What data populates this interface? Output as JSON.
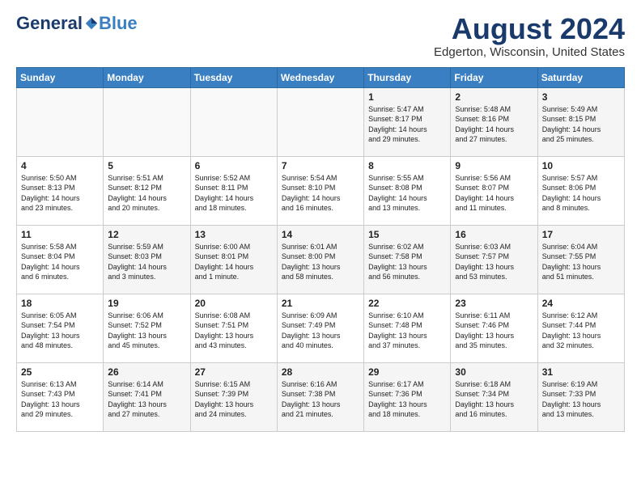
{
  "header": {
    "logo_general": "General",
    "logo_blue": "Blue",
    "title": "August 2024",
    "subtitle": "Edgerton, Wisconsin, United States"
  },
  "days_of_week": [
    "Sunday",
    "Monday",
    "Tuesday",
    "Wednesday",
    "Thursday",
    "Friday",
    "Saturday"
  ],
  "weeks": [
    [
      {
        "day": "",
        "info": ""
      },
      {
        "day": "",
        "info": ""
      },
      {
        "day": "",
        "info": ""
      },
      {
        "day": "",
        "info": ""
      },
      {
        "day": "1",
        "info": "Sunrise: 5:47 AM\nSunset: 8:17 PM\nDaylight: 14 hours\nand 29 minutes."
      },
      {
        "day": "2",
        "info": "Sunrise: 5:48 AM\nSunset: 8:16 PM\nDaylight: 14 hours\nand 27 minutes."
      },
      {
        "day": "3",
        "info": "Sunrise: 5:49 AM\nSunset: 8:15 PM\nDaylight: 14 hours\nand 25 minutes."
      }
    ],
    [
      {
        "day": "4",
        "info": "Sunrise: 5:50 AM\nSunset: 8:13 PM\nDaylight: 14 hours\nand 23 minutes."
      },
      {
        "day": "5",
        "info": "Sunrise: 5:51 AM\nSunset: 8:12 PM\nDaylight: 14 hours\nand 20 minutes."
      },
      {
        "day": "6",
        "info": "Sunrise: 5:52 AM\nSunset: 8:11 PM\nDaylight: 14 hours\nand 18 minutes."
      },
      {
        "day": "7",
        "info": "Sunrise: 5:54 AM\nSunset: 8:10 PM\nDaylight: 14 hours\nand 16 minutes."
      },
      {
        "day": "8",
        "info": "Sunrise: 5:55 AM\nSunset: 8:08 PM\nDaylight: 14 hours\nand 13 minutes."
      },
      {
        "day": "9",
        "info": "Sunrise: 5:56 AM\nSunset: 8:07 PM\nDaylight: 14 hours\nand 11 minutes."
      },
      {
        "day": "10",
        "info": "Sunrise: 5:57 AM\nSunset: 8:06 PM\nDaylight: 14 hours\nand 8 minutes."
      }
    ],
    [
      {
        "day": "11",
        "info": "Sunrise: 5:58 AM\nSunset: 8:04 PM\nDaylight: 14 hours\nand 6 minutes."
      },
      {
        "day": "12",
        "info": "Sunrise: 5:59 AM\nSunset: 8:03 PM\nDaylight: 14 hours\nand 3 minutes."
      },
      {
        "day": "13",
        "info": "Sunrise: 6:00 AM\nSunset: 8:01 PM\nDaylight: 14 hours\nand 1 minute."
      },
      {
        "day": "14",
        "info": "Sunrise: 6:01 AM\nSunset: 8:00 PM\nDaylight: 13 hours\nand 58 minutes."
      },
      {
        "day": "15",
        "info": "Sunrise: 6:02 AM\nSunset: 7:58 PM\nDaylight: 13 hours\nand 56 minutes."
      },
      {
        "day": "16",
        "info": "Sunrise: 6:03 AM\nSunset: 7:57 PM\nDaylight: 13 hours\nand 53 minutes."
      },
      {
        "day": "17",
        "info": "Sunrise: 6:04 AM\nSunset: 7:55 PM\nDaylight: 13 hours\nand 51 minutes."
      }
    ],
    [
      {
        "day": "18",
        "info": "Sunrise: 6:05 AM\nSunset: 7:54 PM\nDaylight: 13 hours\nand 48 minutes."
      },
      {
        "day": "19",
        "info": "Sunrise: 6:06 AM\nSunset: 7:52 PM\nDaylight: 13 hours\nand 45 minutes."
      },
      {
        "day": "20",
        "info": "Sunrise: 6:08 AM\nSunset: 7:51 PM\nDaylight: 13 hours\nand 43 minutes."
      },
      {
        "day": "21",
        "info": "Sunrise: 6:09 AM\nSunset: 7:49 PM\nDaylight: 13 hours\nand 40 minutes."
      },
      {
        "day": "22",
        "info": "Sunrise: 6:10 AM\nSunset: 7:48 PM\nDaylight: 13 hours\nand 37 minutes."
      },
      {
        "day": "23",
        "info": "Sunrise: 6:11 AM\nSunset: 7:46 PM\nDaylight: 13 hours\nand 35 minutes."
      },
      {
        "day": "24",
        "info": "Sunrise: 6:12 AM\nSunset: 7:44 PM\nDaylight: 13 hours\nand 32 minutes."
      }
    ],
    [
      {
        "day": "25",
        "info": "Sunrise: 6:13 AM\nSunset: 7:43 PM\nDaylight: 13 hours\nand 29 minutes."
      },
      {
        "day": "26",
        "info": "Sunrise: 6:14 AM\nSunset: 7:41 PM\nDaylight: 13 hours\nand 27 minutes."
      },
      {
        "day": "27",
        "info": "Sunrise: 6:15 AM\nSunset: 7:39 PM\nDaylight: 13 hours\nand 24 minutes."
      },
      {
        "day": "28",
        "info": "Sunrise: 6:16 AM\nSunset: 7:38 PM\nDaylight: 13 hours\nand 21 minutes."
      },
      {
        "day": "29",
        "info": "Sunrise: 6:17 AM\nSunset: 7:36 PM\nDaylight: 13 hours\nand 18 minutes."
      },
      {
        "day": "30",
        "info": "Sunrise: 6:18 AM\nSunset: 7:34 PM\nDaylight: 13 hours\nand 16 minutes."
      },
      {
        "day": "31",
        "info": "Sunrise: 6:19 AM\nSunset: 7:33 PM\nDaylight: 13 hours\nand 13 minutes."
      }
    ]
  ]
}
